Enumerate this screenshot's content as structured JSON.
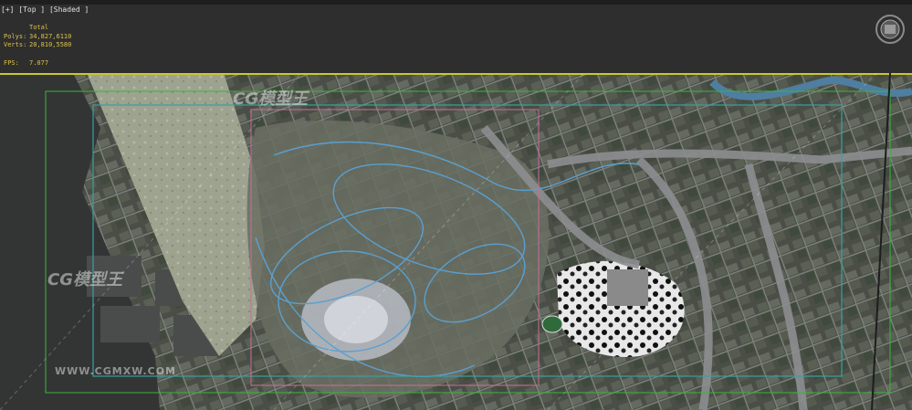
{
  "viewport": {
    "label": "[+] [Top ] [Shaded ]",
    "stats": {
      "header": "Total",
      "polys_label": "Polys:",
      "polys_value": "34,827,6110",
      "verts_label": "Verts:",
      "verts_value": "20,810,5580",
      "fps_label": "FPS:",
      "fps_value": "7.077"
    },
    "navcube_icon": "view-cube-icon"
  },
  "watermarks": [
    "CG模型王",
    "CG模型王",
    "WWW.CGMXW.COM"
  ],
  "colors": {
    "stats_text": "#dcc24a",
    "selection_yellow": "#c8c832",
    "green_frame": "#3cb43c",
    "cyan_frame": "#3aa0a0",
    "pink_frame": "#c86e9a",
    "spline_blue": "#5aa0d0"
  }
}
